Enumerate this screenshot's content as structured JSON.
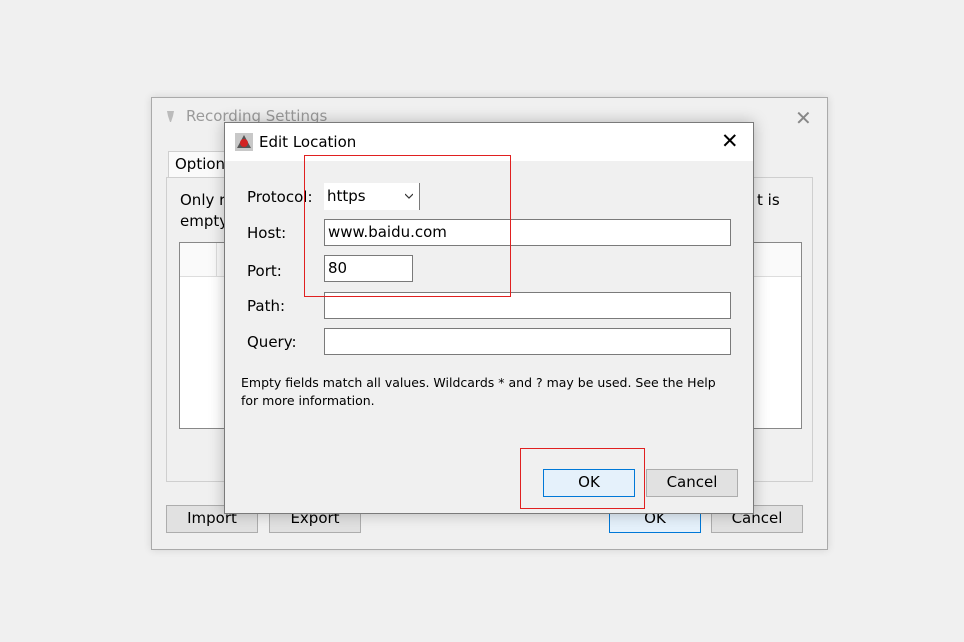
{
  "background_window": {
    "title": "Recording Settings",
    "tab_label": "Option",
    "description_line1": "Only re",
    "description_line2": "empty",
    "description_trailing": "t is",
    "import_label": "Import",
    "export_label": "Export",
    "ok_label": "OK",
    "cancel_label": "Cancel"
  },
  "dialog": {
    "title": "Edit Location",
    "protocol_label": "Protocol:",
    "protocol_value": "https",
    "host_label": "Host:",
    "host_value": "www.baidu.com",
    "port_label": "Port:",
    "port_value": "80",
    "path_label": "Path:",
    "path_value": "",
    "query_label": "Query:",
    "query_value": "",
    "note": "Empty fields match all values. Wildcards * and ? may be used. See the Help for more information.",
    "ok_label": "OK",
    "cancel_label": "Cancel"
  },
  "annotations": {
    "highlight_color": "#e02020"
  }
}
